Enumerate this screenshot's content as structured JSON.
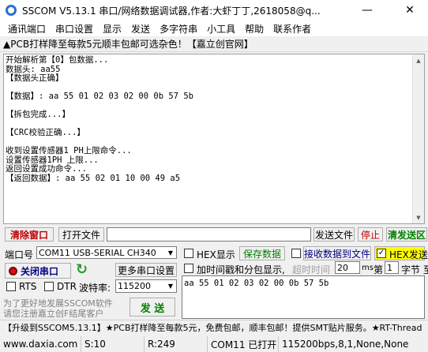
{
  "window": {
    "title": "SSCOM V5.13.1 串口/网络数据调试器,作者:大虾丁丁,2618058@q...",
    "minimize": "—",
    "close": "✕"
  },
  "menu": [
    "通讯端口",
    "串口设置",
    "显示",
    "发送",
    "多字符串",
    "小工具",
    "帮助",
    "联系作者"
  ],
  "ad_bar": "▲PCB打样降至每款5元顺丰包邮可选杂色！【嘉立创官网】",
  "receive": {
    "lines": [
      "开始解析第【0】包数据...",
      "数据头: aa55",
      "【数据头正确】",
      "",
      "【数据】: aa 55 01 02 03 02 00 0b 57 5b",
      "",
      "【拆包完成...】",
      "",
      "【CRC校验正确...】",
      "",
      "收到设置传感器1 PH上限命令...",
      "设置传感器1PH 上限...",
      "返回设置成功命令...",
      "【返回数据】: aa 55 02 01 10 00 49 a5"
    ]
  },
  "toolbar": {
    "clear_window": "清除窗口",
    "open_file": "打开文件",
    "file_path": "",
    "send_file": "发送文件",
    "stop": "停止",
    "clear_send": "清发送区"
  },
  "port": {
    "label": "端口号",
    "value": "COM11 USB-SERIAL CH340",
    "more_settings": "更多串口设置",
    "close_port": "关闭串口",
    "rts": "RTS",
    "dtr": "DTR",
    "baud_label": "波特率:",
    "baud_value": "115200",
    "promo_line1": "为了更好地发展SSCOM软件",
    "promo_line2": "请您注册嘉立创F结尾客户",
    "send": "发 送"
  },
  "options": {
    "hex_display": "HEX显示",
    "save_data": "保存数据",
    "recv_to_file": "接收数据到文件",
    "hex_send": "HEX发送",
    "hex_send_checked": true,
    "add_timestamp": "加时间戳和分包显示,",
    "timeout_label": "超时时间",
    "timeout_value": "20",
    "timeout_unit": "ms",
    "nth_label": "第",
    "nth_value": "1",
    "byte_label": "字节 至"
  },
  "send_data": "aa 55 01 02 03 02 00 0b 57 5b",
  "promo_bar": "【升级到SSCOM5.13.1】★PCB打样降至每款5元，免费包邮，顺丰包邮！提供SMT贴片服务。★RT-Thread",
  "status": {
    "website": "www.daxia.com",
    "sent": "S:10",
    "received": "R:249",
    "port_state": "COM11 已打开",
    "port_params": "115200bps,8,1,None,None"
  },
  "colors": {
    "clear_window_text": "#c00000",
    "stop_text": "#c00000",
    "clear_send_text": "#008000",
    "save_data_text": "#008000",
    "recv_to_file_text": "#000080",
    "hex_send_bg": "#ffff00",
    "close_port_text": "#000080",
    "send_button_text": "#008000"
  }
}
